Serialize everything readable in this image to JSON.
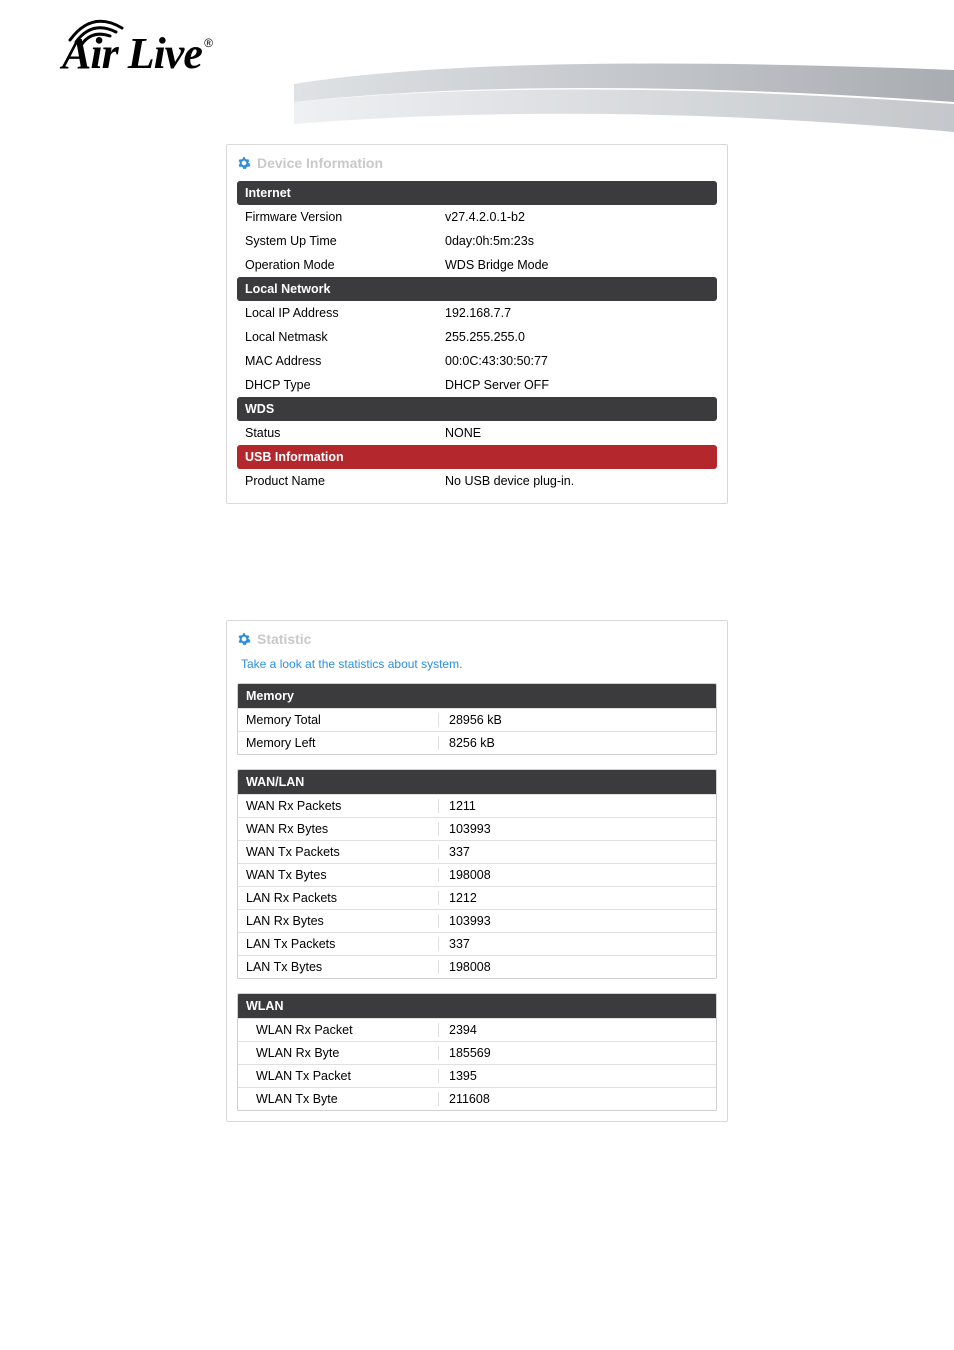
{
  "logo": {
    "text": "Air Live",
    "reg": "®"
  },
  "device_info": {
    "title": "Device Information",
    "sections": [
      {
        "header": "Internet",
        "rows": [
          {
            "label": "Firmware Version",
            "value": "v27.4.2.0.1-b2"
          },
          {
            "label": "System Up Time",
            "value": "0day:0h:5m:23s"
          },
          {
            "label": "Operation Mode",
            "value": "WDS Bridge Mode"
          }
        ]
      },
      {
        "header": "Local Network",
        "rows": [
          {
            "label": "Local IP Address",
            "value": "192.168.7.7"
          },
          {
            "label": "Local Netmask",
            "value": "255.255.255.0"
          },
          {
            "label": "MAC Address",
            "value": "00:0C:43:30:50:77"
          },
          {
            "label": "DHCP Type",
            "value": "DHCP Server OFF"
          }
        ]
      },
      {
        "header": "WDS",
        "rows": [
          {
            "label": "Status",
            "value": "NONE"
          }
        ]
      },
      {
        "header": "USB Information",
        "style": "usb",
        "rows": [
          {
            "label": "Product Name",
            "value": "No USB device plug-in."
          }
        ]
      }
    ]
  },
  "statistic": {
    "title": "Statistic",
    "subtitle": "Take a look at the statistics about system.",
    "tables": [
      {
        "header": "Memory",
        "rows": [
          {
            "label": "Memory Total",
            "value": "28956 kB"
          },
          {
            "label": "Memory Left",
            "value": "8256 kB"
          }
        ]
      },
      {
        "header": "WAN/LAN",
        "rows": [
          {
            "label": "WAN Rx Packets",
            "value": "1211"
          },
          {
            "label": "WAN Rx Bytes",
            "value": "103993"
          },
          {
            "label": "WAN Tx Packets",
            "value": "337"
          },
          {
            "label": "WAN Tx Bytes",
            "value": "198008"
          },
          {
            "label": "LAN Rx Packets",
            "value": "1212"
          },
          {
            "label": "LAN Rx Bytes",
            "value": "103993"
          },
          {
            "label": "LAN Tx Packets",
            "value": "337"
          },
          {
            "label": "LAN Tx Bytes",
            "value": "198008"
          }
        ]
      },
      {
        "header": "WLAN",
        "indent": true,
        "rows": [
          {
            "label": "WLAN Rx Packet",
            "value": "2394"
          },
          {
            "label": "WLAN Rx Byte",
            "value": "185569"
          },
          {
            "label": "WLAN Tx Packet",
            "value": "1395"
          },
          {
            "label": "WLAN Tx Byte",
            "value": "211608"
          }
        ]
      }
    ]
  }
}
